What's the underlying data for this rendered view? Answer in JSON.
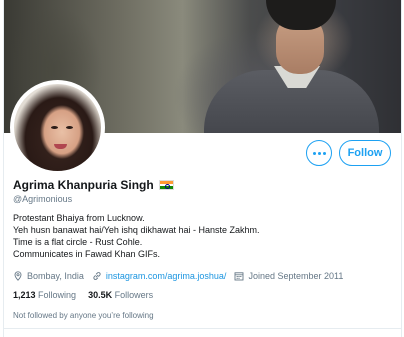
{
  "profile": {
    "name": "Agrima Khanpuria Singh",
    "handle": "@Agrimonious",
    "flag_emoji": "flag-india",
    "bio_lines": [
      "Protestant Bhaiya from Lucknow.",
      "Yeh husn banawat hai/Yeh ishq dikhawat hai - Hanste Zakhm.",
      "Time is a flat circle - Rust Cohle.",
      "Communicates in Fawad Khan GIFs."
    ],
    "location": "Bombay, India",
    "website": "instagram.com/agrima.joshua/",
    "joined": "Joined September 2011",
    "following_count": "1,213",
    "following_label": "Following",
    "followers_count": "30.5K",
    "followers_label": "Followers",
    "followed_by_note": "Not followed by anyone you’re following"
  },
  "actions": {
    "more_icon": "ellipsis-icon",
    "follow_label": "Follow"
  },
  "colors": {
    "accent": "#1da1f2",
    "link": "#1b95e0",
    "secondary_text": "#657786"
  }
}
